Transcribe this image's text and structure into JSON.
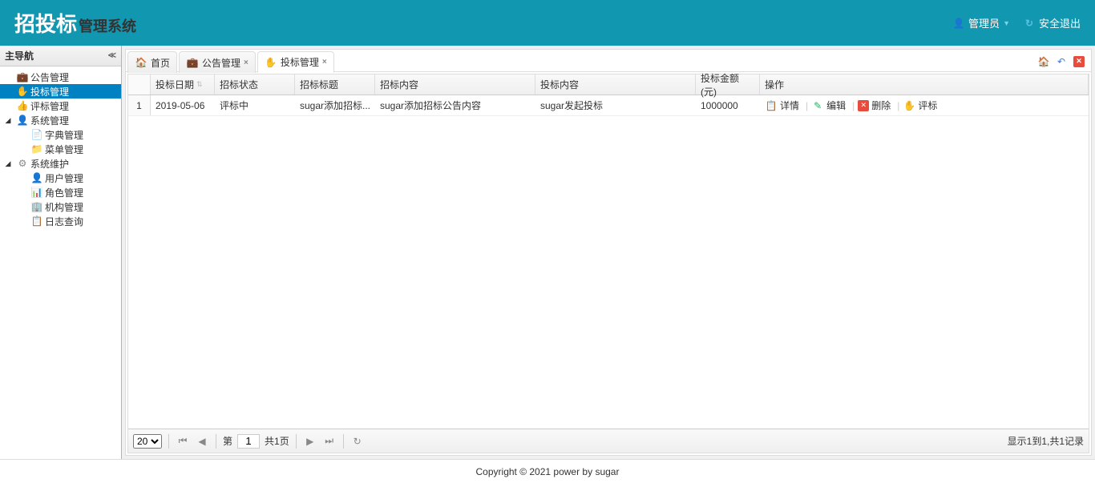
{
  "header": {
    "logo_main": "招投标",
    "logo_sub": "管理系统",
    "user_label": "管理员",
    "logout_label": "安全退出"
  },
  "sidebar": {
    "title": "主导航",
    "items": [
      {
        "label": "公告管理",
        "icon": "briefcase"
      },
      {
        "label": "投标管理",
        "icon": "hand",
        "selected": true
      },
      {
        "label": "评标管理",
        "icon": "thumb"
      },
      {
        "label": "系统管理",
        "icon": "userhead",
        "expandable": true,
        "expanded": true
      },
      {
        "label": "字典管理",
        "icon": "doc",
        "nested": true
      },
      {
        "label": "菜单管理",
        "icon": "folder",
        "nested": true
      },
      {
        "label": "系统维护",
        "icon": "gear",
        "expandable": true,
        "expanded": true
      },
      {
        "label": "用户管理",
        "icon": "userhead",
        "nested": true
      },
      {
        "label": "角色管理",
        "icon": "roles",
        "nested": true
      },
      {
        "label": "机构管理",
        "icon": "org",
        "nested": true
      },
      {
        "label": "日志查询",
        "icon": "log",
        "nested": true
      }
    ]
  },
  "tabs": [
    {
      "label": "首页",
      "icon": "home",
      "closable": false
    },
    {
      "label": "公告管理",
      "icon": "briefcase",
      "closable": true
    },
    {
      "label": "投标管理",
      "icon": "hand",
      "closable": true,
      "active": true
    }
  ],
  "grid": {
    "columns": {
      "date": "投标日期",
      "status": "招标状态",
      "title": "招标标题",
      "content": "招标内容",
      "bid": "投标内容",
      "amount": "投标金额(元)",
      "ops": "操作"
    },
    "rows": [
      {
        "rownum": "1",
        "date": "2019-05-06",
        "status": "评标中",
        "title": "sugar添加招标...",
        "content": "sugar添加招标公告内容",
        "bid": "sugar发起投标",
        "amount": "1000000"
      }
    ],
    "ops": {
      "detail": "详情",
      "edit": "编辑",
      "delete": "删除",
      "review": "评标"
    }
  },
  "pager": {
    "page_size_options": [
      "20"
    ],
    "page_size": "20",
    "page_prefix": "第",
    "page_current": "1",
    "page_suffix": "共1页",
    "info": "显示1到1,共1记录"
  },
  "footer": "Copyright © 2021 power by sugar"
}
